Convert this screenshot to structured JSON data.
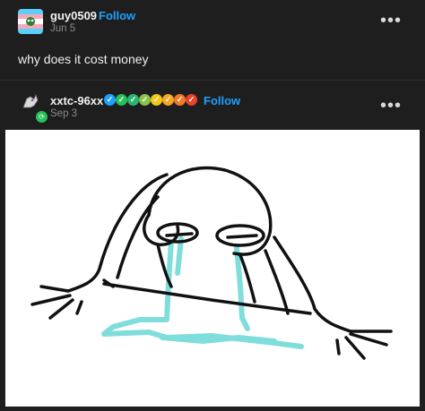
{
  "post1": {
    "username": "guy0509",
    "follow_label": "Follow",
    "date": "Jun 5",
    "more_label": "•••",
    "body": "why does it cost money"
  },
  "post2": {
    "username": "xxtc-96xx",
    "follow_label": "Follow",
    "date": "Sep 3",
    "more_label": "•••",
    "badge_colors": [
      "#1fa0ff",
      "#27c15a",
      "#2bb673",
      "#8bc34a",
      "#f5c518",
      "#f5a623",
      "#f07a2a",
      "#e8432b"
    ]
  },
  "colors": {
    "background": "#1e1e1e",
    "accent": "#1fa0ff",
    "tears": "#7fdedc"
  }
}
